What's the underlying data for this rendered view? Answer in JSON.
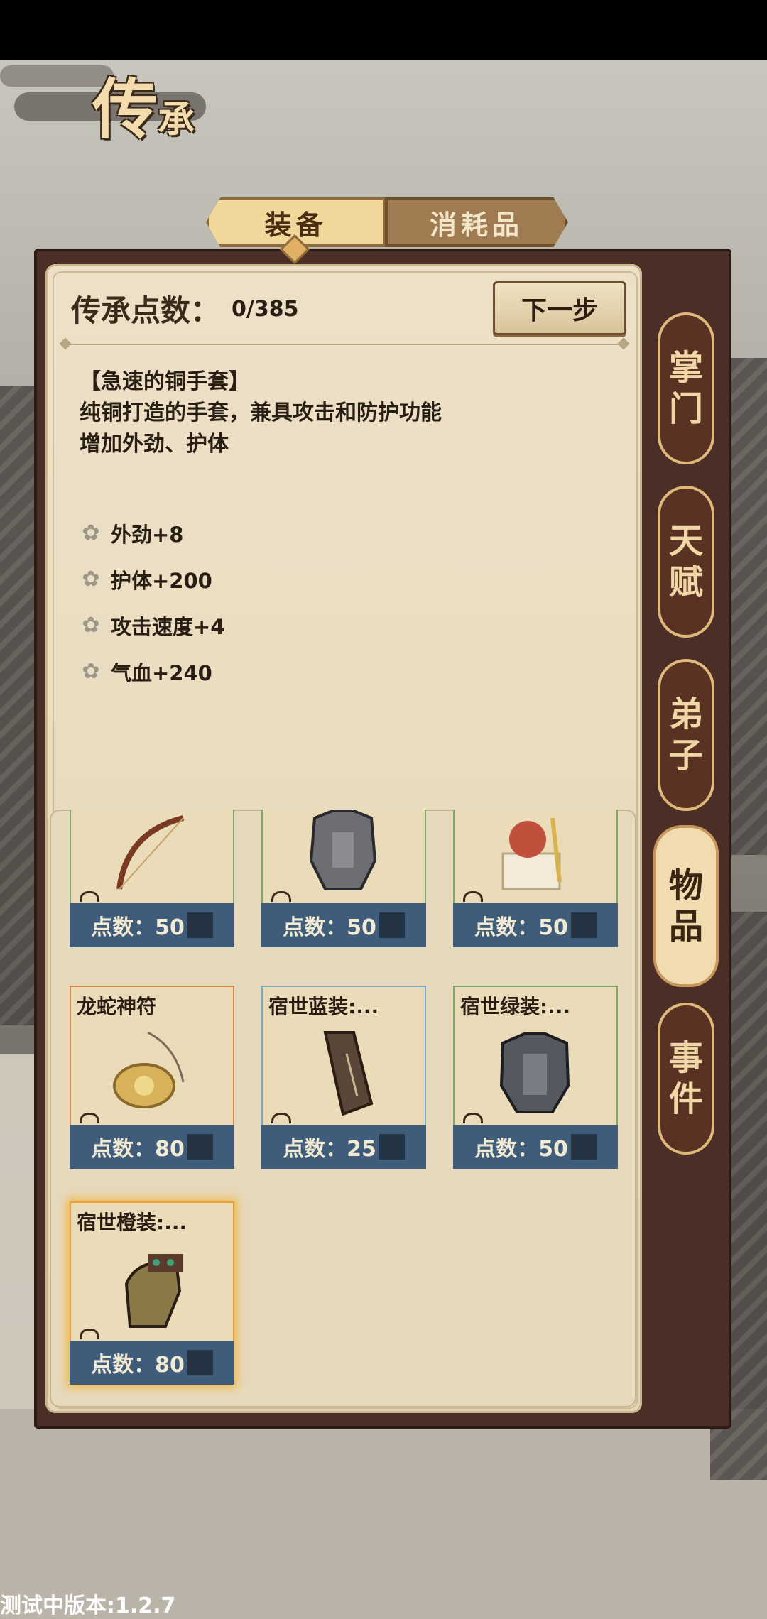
{
  "title": {
    "main": "传",
    "sub": "承"
  },
  "tabs": {
    "equipment": "装备",
    "consumables": "消耗品"
  },
  "points": {
    "label": "传承点数：",
    "value": "0/385"
  },
  "next_button": "下一步",
  "item_detail": {
    "name": "【急速的铜手套】",
    "desc_line1": "纯铜打造的手套，兼具攻击和防护功能",
    "desc_line2": "增加外劲、护体",
    "stats": [
      "外劲+8",
      "护体+200",
      "攻击速度+4",
      "气血+240"
    ]
  },
  "cards": [
    {
      "name": "",
      "cost": "点数：50",
      "border": "#7da86a",
      "icon": "bow-icon"
    },
    {
      "name": "",
      "cost": "点数：50",
      "border": "#7da86a",
      "icon": "armor-icon"
    },
    {
      "name": "",
      "cost": "点数：50",
      "border": "#7da86a",
      "icon": "seal-icon"
    },
    {
      "name": "龙蛇神符",
      "cost": "点数：80",
      "border": "#d98a4a",
      "icon": "talisman-icon"
    },
    {
      "name": "宿世蓝装:...",
      "cost": "点数：25",
      "border": "#7aa8cf",
      "icon": "token-icon"
    },
    {
      "name": "宿世绿装:...",
      "cost": "点数：50",
      "border": "#7da86a",
      "icon": "armor-icon"
    },
    {
      "name": "宿世橙装:...",
      "cost": "点数：80",
      "border": "#e8a13a",
      "icon": "glove-icon"
    }
  ],
  "side_tabs": [
    {
      "label1": "掌",
      "label2": "门"
    },
    {
      "label1": "天",
      "label2": "赋"
    },
    {
      "label1": "弟",
      "label2": "子"
    },
    {
      "label1": "物",
      "label2": "品"
    },
    {
      "label1": "事",
      "label2": "件"
    }
  ],
  "version": "测试中版本:1.2.7"
}
